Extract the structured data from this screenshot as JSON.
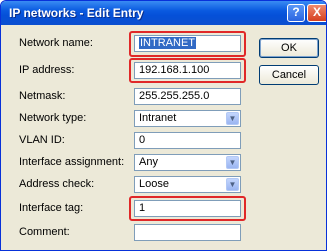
{
  "window": {
    "title": "IP networks - Edit Entry"
  },
  "titlebar": {
    "help_glyph": "?",
    "close_glyph": "X"
  },
  "fields": {
    "network_name": {
      "label": "Network name:",
      "value": "INTRANET"
    },
    "ip_address": {
      "label": "IP address:",
      "value": "192.168.1.100"
    },
    "netmask": {
      "label": "Netmask:",
      "value": "255.255.255.0"
    },
    "network_type": {
      "label": "Network type:",
      "value": "Intranet"
    },
    "vlan_id": {
      "label": "VLAN ID:",
      "value": "0"
    },
    "interface_assignment": {
      "label": "Interface assignment:",
      "value": "Any"
    },
    "address_check": {
      "label": "Address check:",
      "value": "Loose"
    },
    "interface_tag": {
      "label": "Interface tag:",
      "value": "1"
    },
    "comment": {
      "label": "Comment:",
      "value": ""
    }
  },
  "buttons": {
    "ok": "OK",
    "cancel": "Cancel"
  },
  "dropdown_glyph": "▼",
  "colors": {
    "highlight_box": "#e02828",
    "title_bar": "#0a5ae0",
    "selection": "#316ac5"
  }
}
